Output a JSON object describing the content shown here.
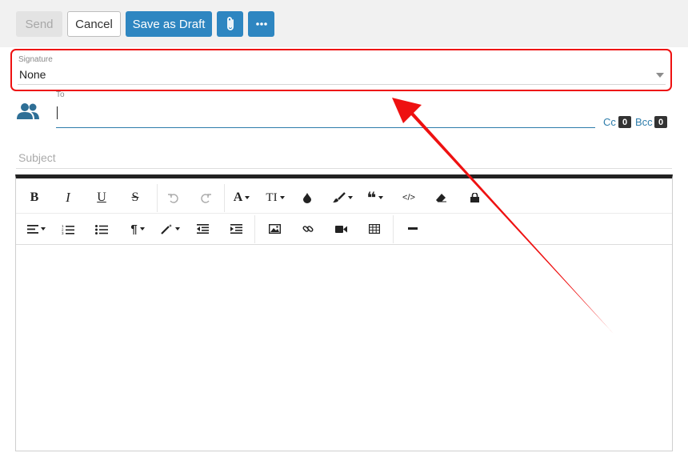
{
  "toolbar": {
    "send_label": "Send",
    "cancel_label": "Cancel",
    "draft_label": "Save as Draft",
    "attach_icon": "paperclip-icon",
    "more_icon": "ellipsis-icon"
  },
  "signature": {
    "label": "Signature",
    "value": "None"
  },
  "recipients": {
    "to_label": "To",
    "to_value": "",
    "cc_label": "Cc",
    "cc_count": "0",
    "bcc_label": "Bcc",
    "bcc_count": "0"
  },
  "subject": {
    "placeholder": "Subject",
    "value": ""
  },
  "editor_toolbar": {
    "row1": [
      "bold",
      "italic",
      "underline",
      "strikethrough",
      "undo",
      "redo",
      "font",
      "font-size",
      "color",
      "style",
      "blockquote",
      "code-view",
      "clear-format",
      "lock"
    ],
    "row2": [
      "align",
      "ordered-list",
      "unordered-list",
      "paragraph",
      "magic",
      "outdent",
      "indent",
      "image",
      "link",
      "video",
      "table",
      "horizontal-rule"
    ]
  },
  "colors": {
    "accent": "#2e86c1",
    "highlight": "#ee1111"
  }
}
